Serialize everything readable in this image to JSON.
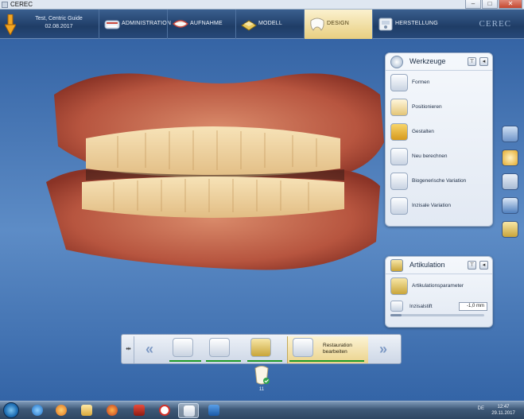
{
  "window": {
    "title": "CEREC",
    "minimize": "–",
    "maximize": "□",
    "close": "✕"
  },
  "patient": {
    "name": "Test, Centric Guide",
    "date": "02.08.2017"
  },
  "steps": [
    {
      "label": "ADMINISTRATION",
      "icon": "administration-icon",
      "active": false
    },
    {
      "label": "AUFNAHME",
      "icon": "aufnahme-icon",
      "active": false
    },
    {
      "label": "MODELL",
      "icon": "modell-icon",
      "active": false
    },
    {
      "label": "DESIGN",
      "icon": "design-icon",
      "active": true
    },
    {
      "label": "HERSTELLUNG",
      "icon": "herstellung-icon",
      "active": false
    }
  ],
  "brand": "CEREC",
  "werkzeuge": {
    "title": "Werkzeuge",
    "tools": [
      {
        "label": "Formen",
        "icon": "formen-icon"
      },
      {
        "label": "Positionieren",
        "icon": "positionieren-icon"
      },
      {
        "label": "Gestalten",
        "icon": "gestalten-icon"
      },
      {
        "label": "Neu berechnen",
        "icon": "neu-berechnen-icon"
      },
      {
        "label": "Biogenerische Variation",
        "icon": "biogenerische-variation-icon"
      },
      {
        "label": "Inzisale Variation",
        "icon": "inzisale-variation-icon"
      }
    ]
  },
  "artikulation": {
    "title": "Artikulation",
    "parameter_label": "Artikulationsparameter",
    "inzisalstift_label": "Inzisalstift",
    "inzisalstift_value": "-1,0 mm",
    "slider_level": 0.12
  },
  "workflow": {
    "pin": "⇹",
    "prev": "«",
    "next": "»",
    "active_label": "Restauration bearbeiten"
  },
  "restoration": {
    "tooth_number": "11"
  },
  "taskbar": {
    "language": "DE",
    "time": "12:47",
    "date": "29.11.2017"
  },
  "colors": {
    "accent_active": "#e8cf80",
    "progress_green": "#1e9a28",
    "background": "#4f7fbd"
  }
}
